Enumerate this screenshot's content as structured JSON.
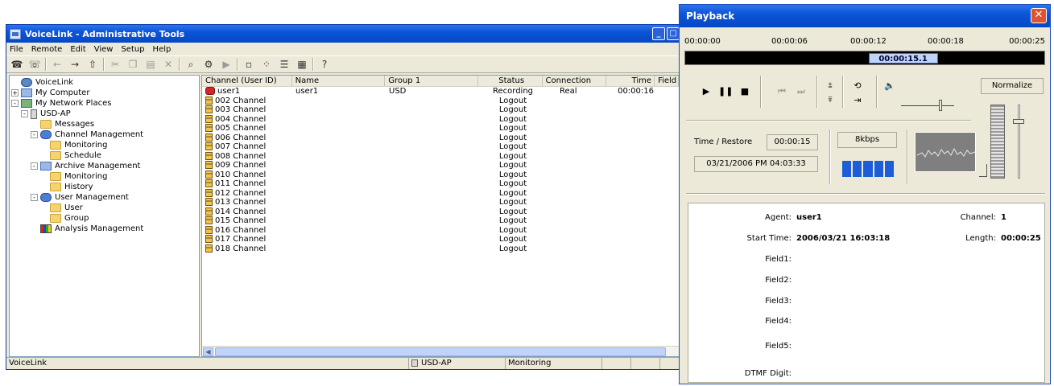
{
  "main": {
    "title": "VoiceLink - Administrative Tools",
    "menu": [
      "File",
      "Remote",
      "Edit",
      "View",
      "Setup",
      "Help"
    ],
    "tree": [
      {
        "label": "VoiceLink",
        "icon": "voicelink-icon",
        "level": 0,
        "expander": ""
      },
      {
        "label": "My Computer",
        "icon": "computer-icon",
        "level": 0,
        "expander": "+"
      },
      {
        "label": "My Network Places",
        "icon": "network-icon",
        "level": 0,
        "expander": "-"
      },
      {
        "label": "USD-AP",
        "icon": "server-icon",
        "level": 1,
        "expander": "-"
      },
      {
        "label": "Messages",
        "icon": "folder-icon",
        "level": 2,
        "expander": ""
      },
      {
        "label": "Channel Management",
        "icon": "channel-management-icon",
        "level": 2,
        "expander": "-"
      },
      {
        "label": "Monitoring",
        "icon": "folder-icon",
        "level": 3,
        "expander": ""
      },
      {
        "label": "Schedule",
        "icon": "folder-icon",
        "level": 3,
        "expander": ""
      },
      {
        "label": "Archive Management",
        "icon": "archive-icon",
        "level": 2,
        "expander": "-"
      },
      {
        "label": "Monitoring",
        "icon": "folder-icon",
        "level": 3,
        "expander": ""
      },
      {
        "label": "History",
        "icon": "folder-icon",
        "level": 3,
        "expander": ""
      },
      {
        "label": "User Management",
        "icon": "users-icon",
        "level": 2,
        "expander": "-"
      },
      {
        "label": "User",
        "icon": "folder-icon",
        "level": 3,
        "expander": ""
      },
      {
        "label": "Group",
        "icon": "folder-icon",
        "level": 3,
        "expander": ""
      },
      {
        "label": "Analysis Management",
        "icon": "chart-icon",
        "level": 2,
        "expander": ""
      }
    ],
    "columns": [
      "Channel (User ID)",
      "Name",
      "Group 1",
      "Status",
      "Connection",
      "Time",
      "Field"
    ],
    "rows": [
      {
        "channel": "user1",
        "name": "user1",
        "group": "USD",
        "status": "Recording",
        "connection": "Real",
        "time": "00:00:16",
        "recording": true
      },
      {
        "channel": "002 Channel",
        "name": "",
        "group": "",
        "status": "Logout",
        "connection": "",
        "time": ""
      },
      {
        "channel": "003 Channel",
        "name": "",
        "group": "",
        "status": "Logout",
        "connection": "",
        "time": ""
      },
      {
        "channel": "004 Channel",
        "name": "",
        "group": "",
        "status": "Logout",
        "connection": "",
        "time": ""
      },
      {
        "channel": "005 Channel",
        "name": "",
        "group": "",
        "status": "Logout",
        "connection": "",
        "time": ""
      },
      {
        "channel": "006 Channel",
        "name": "",
        "group": "",
        "status": "Logout",
        "connection": "",
        "time": ""
      },
      {
        "channel": "007 Channel",
        "name": "",
        "group": "",
        "status": "Logout",
        "connection": "",
        "time": ""
      },
      {
        "channel": "008 Channel",
        "name": "",
        "group": "",
        "status": "Logout",
        "connection": "",
        "time": ""
      },
      {
        "channel": "009 Channel",
        "name": "",
        "group": "",
        "status": "Logout",
        "connection": "",
        "time": ""
      },
      {
        "channel": "010 Channel",
        "name": "",
        "group": "",
        "status": "Logout",
        "connection": "",
        "time": ""
      },
      {
        "channel": "011 Channel",
        "name": "",
        "group": "",
        "status": "Logout",
        "connection": "",
        "time": ""
      },
      {
        "channel": "012 Channel",
        "name": "",
        "group": "",
        "status": "Logout",
        "connection": "",
        "time": ""
      },
      {
        "channel": "013 Channel",
        "name": "",
        "group": "",
        "status": "Logout",
        "connection": "",
        "time": ""
      },
      {
        "channel": "014 Channel",
        "name": "",
        "group": "",
        "status": "Logout",
        "connection": "",
        "time": ""
      },
      {
        "channel": "015 Channel",
        "name": "",
        "group": "",
        "status": "Logout",
        "connection": "",
        "time": ""
      },
      {
        "channel": "016 Channel",
        "name": "",
        "group": "",
        "status": "Logout",
        "connection": "",
        "time": ""
      },
      {
        "channel": "017 Channel",
        "name": "",
        "group": "",
        "status": "Logout",
        "connection": "",
        "time": ""
      },
      {
        "channel": "018 Channel",
        "name": "",
        "group": "",
        "status": "Logout",
        "connection": "",
        "time": ""
      }
    ],
    "statusbar": {
      "left": "VoiceLink",
      "server": "USD-AP",
      "mode": "Monitoring"
    }
  },
  "playback": {
    "title": "Playback",
    "ticks": [
      "00:00:00",
      "00:00:06",
      "00:00:12",
      "00:00:18",
      "00:00:25"
    ],
    "current_time": "00:00:15.1",
    "position_fraction": 0.604,
    "normalize_label": "Normalize",
    "time_restore_label": "Time / Restore",
    "time_restore_value": "00:00:15",
    "rate": "8kbps",
    "datetime": "03/21/2006 PM 04:03:33",
    "info": {
      "agent_label": "Agent:",
      "agent": "user1",
      "channel_label": "Channel:",
      "channel": "1",
      "start_label": "Start Time:",
      "start": "2006/03/21 16:03:18",
      "length_label": "Length:",
      "length": "00:00:25",
      "field1": "Field1:",
      "field2": "Field2:",
      "field3": "Field3:",
      "field4": "Field4:",
      "field5": "Field5:",
      "dtmf": "DTMF Digit:"
    }
  }
}
